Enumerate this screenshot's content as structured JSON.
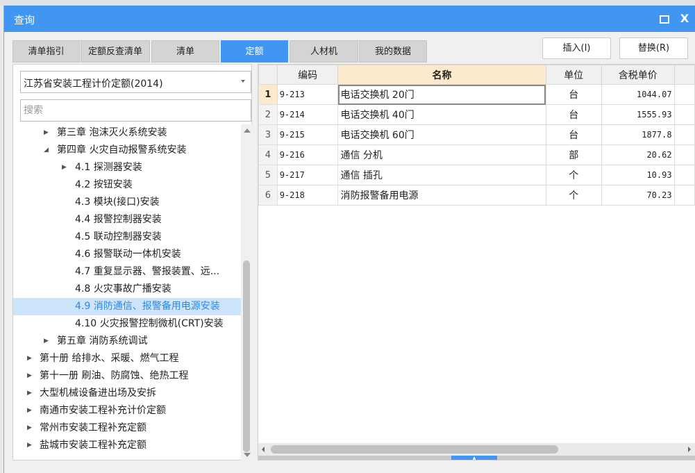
{
  "dialog": {
    "title": "查询",
    "maximize_icon": "maximize-icon",
    "close_icon": "close-icon",
    "close_glyph": "X"
  },
  "tabs": [
    {
      "label": "清单指引"
    },
    {
      "label": "定额反查清单"
    },
    {
      "label": "清单"
    },
    {
      "label": "定额",
      "active": true
    },
    {
      "label": "人材机"
    },
    {
      "label": "我的数据"
    }
  ],
  "actions": {
    "insert": "插入(I)",
    "replace": "替换(R)"
  },
  "left": {
    "library": "江苏省安装工程计价定额(2014)",
    "search_placeholder": "搜索",
    "tree": [
      {
        "label": "第三章 泡沫灭火系统安装",
        "level": 2,
        "state": "collapsed"
      },
      {
        "label": "第四章 火灾自动报警系统安装",
        "level": 2,
        "state": "expanded"
      },
      {
        "label": "4.1 探测器安装",
        "level": 3,
        "state": "collapsed"
      },
      {
        "label": "4.2 按钮安装",
        "level": 3,
        "state": "none"
      },
      {
        "label": "4.3 模块(接口)安装",
        "level": 3,
        "state": "none"
      },
      {
        "label": "4.4 报警控制器安装",
        "level": 3,
        "state": "none"
      },
      {
        "label": "4.5 联动控制器安装",
        "level": 3,
        "state": "none"
      },
      {
        "label": "4.6 报警联动一体机安装",
        "level": 3,
        "state": "none"
      },
      {
        "label": "4.7 重复显示器、警报装置、远...",
        "level": 3,
        "state": "none"
      },
      {
        "label": "4.8 火灾事故广播安装",
        "level": 3,
        "state": "none"
      },
      {
        "label": "4.9 消防通信、报警备用电源安装",
        "level": 3,
        "state": "none",
        "selected": true
      },
      {
        "label": "4.10 火灾报警控制微机(CRT)安装",
        "level": 3,
        "state": "none"
      },
      {
        "label": "第五章 消防系统调试",
        "level": 2,
        "state": "collapsed"
      },
      {
        "label": "第十册 给排水、采暖、燃气工程",
        "level": 1,
        "state": "collapsed"
      },
      {
        "label": "第十一册 刷油、防腐蚀、绝热工程",
        "level": 1,
        "state": "collapsed"
      },
      {
        "label": "大型机械设备进出场及安拆",
        "level": 1,
        "state": "collapsed"
      },
      {
        "label": "南通市安装工程补充计价定额",
        "level": 1,
        "state": "collapsed"
      },
      {
        "label": "常州市安装工程补充定额",
        "level": 1,
        "state": "collapsed"
      },
      {
        "label": "盐城市安装工程补充定额",
        "level": 1,
        "state": "collapsed"
      }
    ]
  },
  "grid": {
    "columns": [
      "",
      "编码",
      "名称",
      "单位",
      "含税单价",
      ""
    ],
    "rows": [
      {
        "n": "1",
        "code": "9-213",
        "name": "电话交换机 20门",
        "unit": "台",
        "price": "1044.07"
      },
      {
        "n": "2",
        "code": "9-214",
        "name": "电话交换机 40门",
        "unit": "台",
        "price": "1555.93"
      },
      {
        "n": "3",
        "code": "9-215",
        "name": "电话交换机 60门",
        "unit": "台",
        "price": "1877.8"
      },
      {
        "n": "4",
        "code": "9-216",
        "name": "通信 分机",
        "unit": "部",
        "price": "20.62"
      },
      {
        "n": "5",
        "code": "9-217",
        "name": "通信 插孔",
        "unit": "个",
        "price": "10.93"
      },
      {
        "n": "6",
        "code": "9-218",
        "name": "消防报警备用电源",
        "unit": "个",
        "price": "70.23"
      }
    ]
  },
  "colors": {
    "accent": "#4196f2",
    "header_highlight": "#fde9cc",
    "selection": "#cce5fb"
  }
}
